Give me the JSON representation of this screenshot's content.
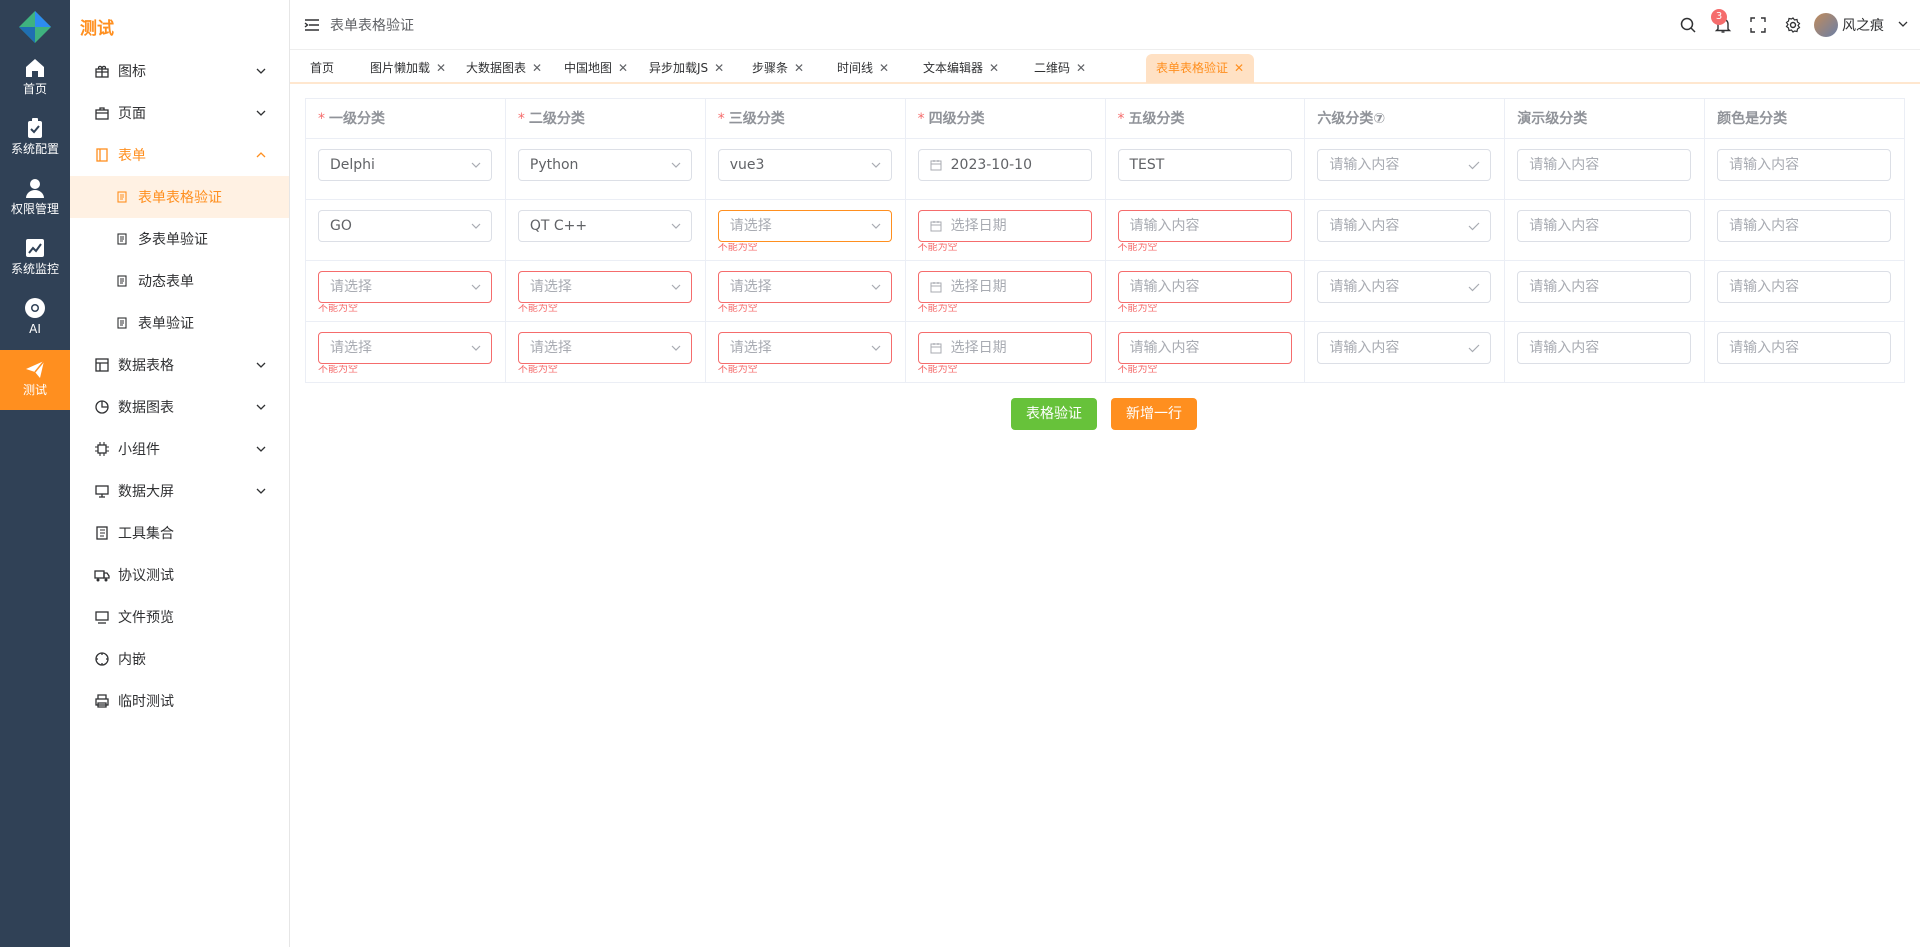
{
  "rail": {
    "items": [
      {
        "label": "首页",
        "icon": "home-icon"
      },
      {
        "label": "系统配置",
        "icon": "clipboard-icon"
      },
      {
        "label": "权限管理",
        "icon": "user-icon"
      },
      {
        "label": "系统监控",
        "icon": "chart-line-icon"
      },
      {
        "label": "AI",
        "icon": "chrome-icon"
      },
      {
        "label": "测试",
        "icon": "paper-plane-icon",
        "active": true
      }
    ]
  },
  "sidebar": {
    "brand": "测试",
    "items": [
      {
        "label": "图标",
        "icon": "gift-icon",
        "arrow": "down"
      },
      {
        "label": "页面",
        "icon": "briefcase-icon",
        "arrow": "down"
      },
      {
        "label": "表单",
        "icon": "form-icon",
        "arrow": "up",
        "open": true
      },
      {
        "label": "表单表格验证",
        "icon": "doc-icon",
        "sub": true,
        "active": true
      },
      {
        "label": "多表单验证",
        "icon": "doc-icon",
        "sub": true
      },
      {
        "label": "动态表单",
        "icon": "doc-icon",
        "sub": true
      },
      {
        "label": "表单验证",
        "icon": "doc-icon",
        "sub": true
      },
      {
        "label": "数据表格",
        "icon": "grid-icon",
        "arrow": "down"
      },
      {
        "label": "数据图表",
        "icon": "pie-icon",
        "arrow": "down"
      },
      {
        "label": "小组件",
        "icon": "cpu-icon",
        "arrow": "down"
      },
      {
        "label": "数据大屏",
        "icon": "screen-icon",
        "arrow": "down"
      },
      {
        "label": "工具集合",
        "icon": "notebook-icon"
      },
      {
        "label": "协议测试",
        "icon": "truck-icon"
      },
      {
        "label": "文件预览",
        "icon": "monitor-icon"
      },
      {
        "label": "内嵌",
        "icon": "compass-icon"
      },
      {
        "label": "临时测试",
        "icon": "printer-icon"
      }
    ]
  },
  "header": {
    "breadcrumb": "表单表格验证",
    "notification_count": "3",
    "username": "风之痕"
  },
  "tabs": [
    {
      "label": "首页",
      "closable": false
    },
    {
      "label": "图片懒加载",
      "closable": true
    },
    {
      "label": "大数据图表",
      "closable": true
    },
    {
      "label": "中国地图",
      "closable": true
    },
    {
      "label": "异步加载JS",
      "closable": true
    },
    {
      "label": "步骤条",
      "closable": true
    },
    {
      "label": "时间线",
      "closable": true
    },
    {
      "label": "文本编辑器",
      "closable": true
    },
    {
      "label": "二维码",
      "closable": true
    },
    {
      "label": "表单表格验证",
      "closable": true,
      "active": true
    }
  ],
  "tab_close_glyph": "✕",
  "table": {
    "columns": [
      {
        "label": "一级分类",
        "required": true
      },
      {
        "label": "二级分类",
        "required": true
      },
      {
        "label": "三级分类",
        "required": true
      },
      {
        "label": "四级分类",
        "required": true
      },
      {
        "label": "五级分类",
        "required": true
      },
      {
        "label": "六级分类⑦",
        "required": false
      },
      {
        "label": "演示级分类",
        "required": false
      },
      {
        "label": "颜色是分类",
        "required": false
      }
    ],
    "error_message": "不能为空",
    "placeholders": {
      "select": "请选择",
      "date": "选择日期",
      "input": "请输入内容"
    },
    "rows": [
      [
        {
          "type": "select",
          "value": "Delphi"
        },
        {
          "type": "select",
          "value": "Python"
        },
        {
          "type": "select",
          "value": "vue3"
        },
        {
          "type": "date",
          "value": "2023-10-10"
        },
        {
          "type": "input",
          "value": "TEST"
        },
        {
          "type": "check",
          "value": ""
        },
        {
          "type": "input",
          "value": ""
        },
        {
          "type": "input",
          "value": ""
        }
      ],
      [
        {
          "type": "select",
          "value": "GO"
        },
        {
          "type": "select",
          "value": "QT C++"
        },
        {
          "type": "select",
          "value": "",
          "error": true,
          "focus": true
        },
        {
          "type": "date",
          "value": "",
          "error": true
        },
        {
          "type": "input",
          "value": "",
          "error": true
        },
        {
          "type": "check",
          "value": ""
        },
        {
          "type": "input",
          "value": ""
        },
        {
          "type": "input",
          "value": ""
        }
      ],
      [
        {
          "type": "select",
          "value": "",
          "error": true
        },
        {
          "type": "select",
          "value": "",
          "error": true
        },
        {
          "type": "select",
          "value": "",
          "error": true
        },
        {
          "type": "date",
          "value": "",
          "error": true
        },
        {
          "type": "input",
          "value": "",
          "error": true
        },
        {
          "type": "check",
          "value": ""
        },
        {
          "type": "input",
          "value": ""
        },
        {
          "type": "input",
          "value": ""
        }
      ],
      [
        {
          "type": "select",
          "value": "",
          "error": true
        },
        {
          "type": "select",
          "value": "",
          "error": true
        },
        {
          "type": "select",
          "value": "",
          "error": true
        },
        {
          "type": "date",
          "value": "",
          "error": true
        },
        {
          "type": "input",
          "value": "",
          "error": true
        },
        {
          "type": "check",
          "value": ""
        },
        {
          "type": "input",
          "value": ""
        },
        {
          "type": "input",
          "value": ""
        }
      ]
    ]
  },
  "buttons": {
    "validate": "表格验证",
    "add_row": "新增一行"
  },
  "colors": {
    "accent": "#ff8f1f",
    "rail": "#304156",
    "error": "#f56c6c",
    "success": "#67c23a"
  }
}
